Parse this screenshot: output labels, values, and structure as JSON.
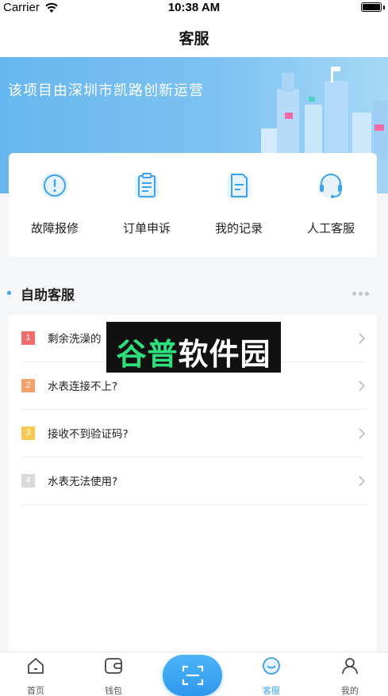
{
  "status_bar": {
    "carrier": "Carrier",
    "time": "10:38 AM"
  },
  "nav": {
    "title": "客服"
  },
  "banner": {
    "text": "该项目由深圳市凯路创新运营"
  },
  "quick_actions": [
    {
      "label": "故障报修",
      "icon": "alert-icon"
    },
    {
      "label": "订单申诉",
      "icon": "clipboard-icon"
    },
    {
      "label": "我的记录",
      "icon": "document-icon"
    },
    {
      "label": "人工客服",
      "icon": "headset-icon"
    }
  ],
  "self_service": {
    "title": "自助客服",
    "items": [
      {
        "num": "1",
        "text": "剩余洗澡的",
        "color": "#f26b6b"
      },
      {
        "num": "2",
        "text": "水表连接不上?",
        "color": "#f8a06c"
      },
      {
        "num": "3",
        "text": "接收不到验证码?",
        "color": "#f9c752"
      },
      {
        "num": "4",
        "text": "水表无法使用?",
        "color": "#d9d9d9"
      }
    ]
  },
  "watermark": {
    "part1": "谷普",
    "part2": "软件园"
  },
  "tab_bar": {
    "tabs": [
      {
        "label": "首页",
        "icon": "home-icon"
      },
      {
        "label": "钱包",
        "icon": "wallet-icon"
      },
      {
        "label": "客服",
        "icon": "service-icon",
        "active": true
      },
      {
        "label": "我的",
        "icon": "profile-icon"
      }
    ],
    "scan": {
      "icon": "scan-icon"
    }
  },
  "colors": {
    "accent": "#36a3f5",
    "banner": "#66b7ef"
  }
}
